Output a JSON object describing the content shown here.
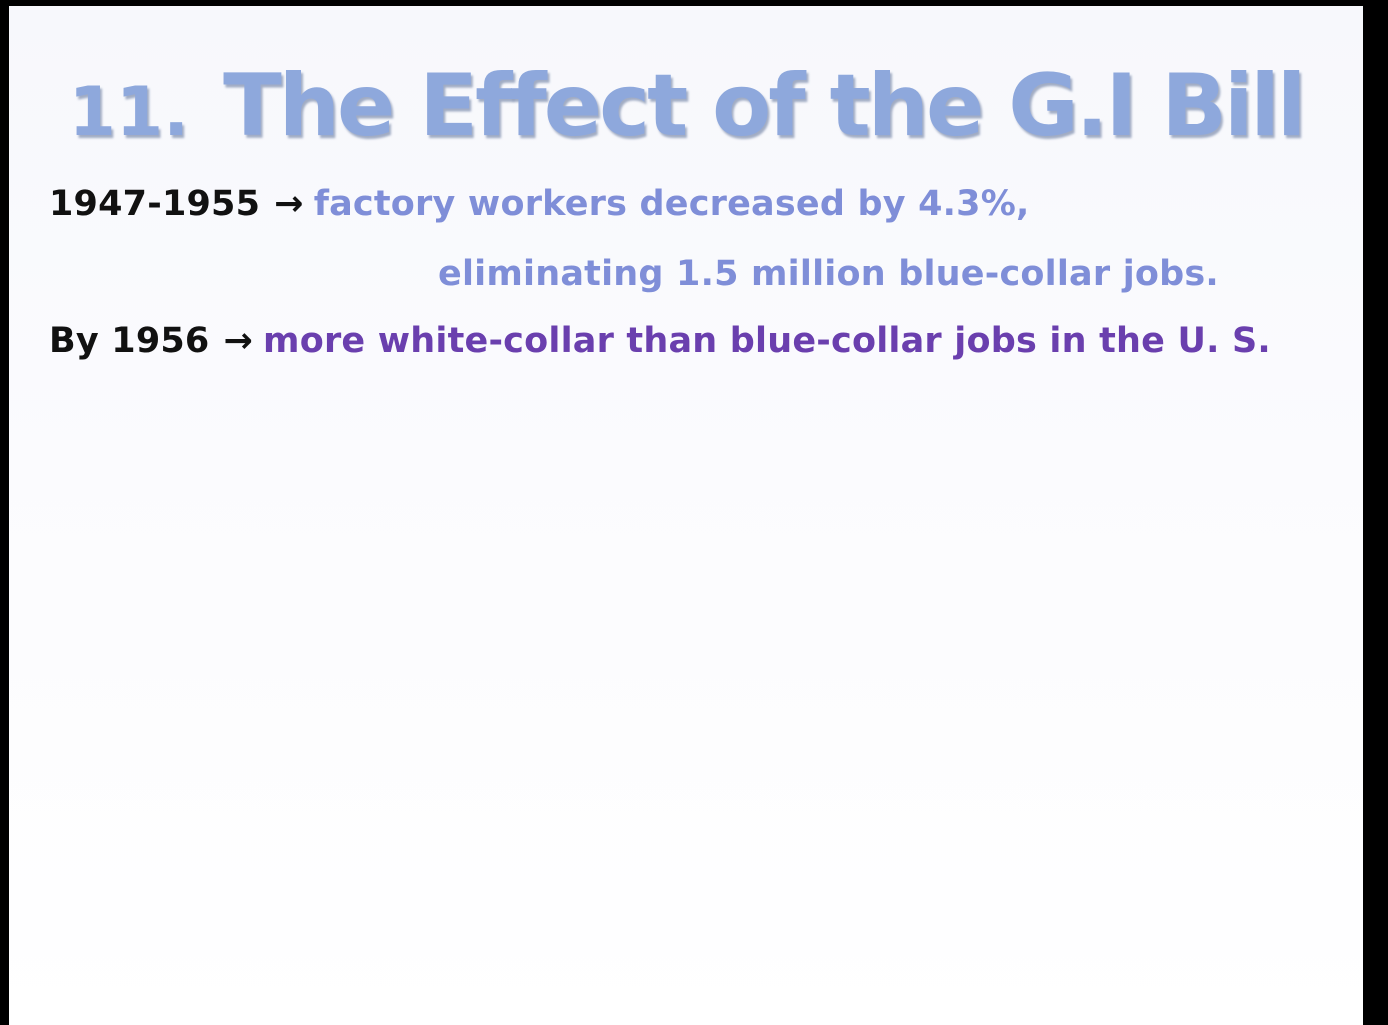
{
  "slide": {
    "title_number": "11.",
    "title_text": "The Effect of the G.I Bill",
    "arrow_glyph": "→",
    "lines": [
      {
        "lead": "1947-1955",
        "text": "factory workers decreased by 4.3%,"
      },
      {
        "text": "eliminating 1.5 million blue-collar jobs."
      },
      {
        "lead": "By 1956",
        "text": "more white-collar than blue-collar jobs in the U. S."
      }
    ]
  },
  "colors": {
    "title": "#8ea8dc",
    "lead_text": "#111111",
    "line_blue": "#7f8ed8",
    "line_purple": "#6a3fae",
    "frame": "#000000"
  }
}
